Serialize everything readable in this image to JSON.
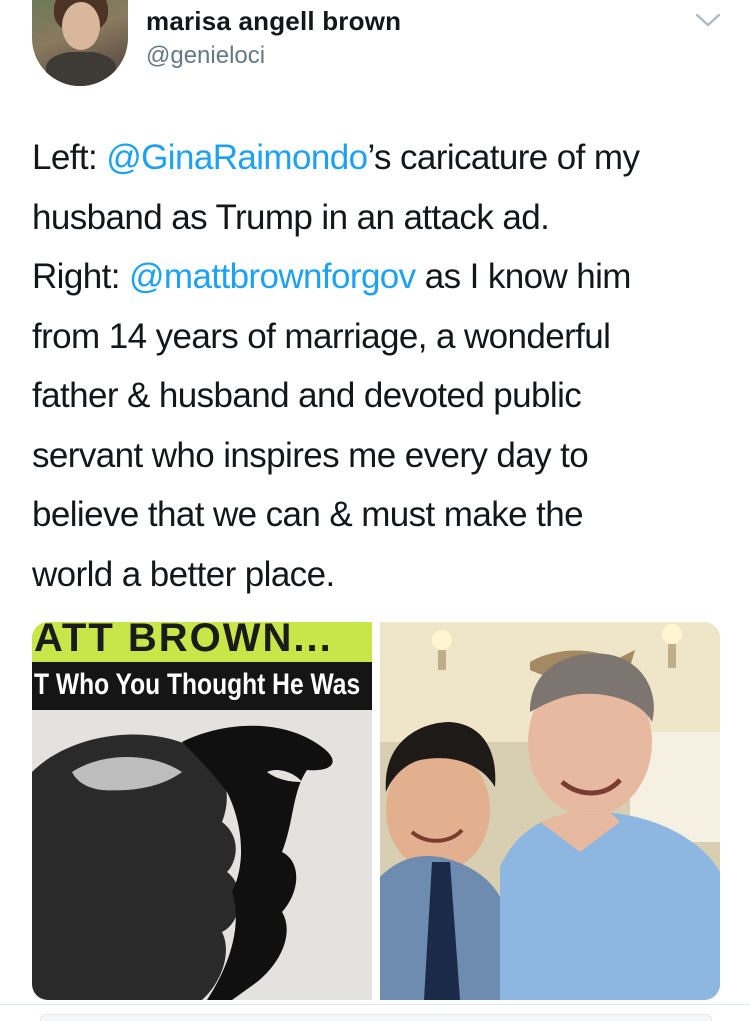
{
  "author": {
    "name": "marisa angell brown",
    "handle": "@genieloci"
  },
  "tweet": {
    "segments": [
      {
        "text": "Left: ",
        "mention": false
      },
      {
        "text": "@GinaRaimondo",
        "mention": true
      },
      {
        "text": "’s caricature of my\nhusband as Trump in an attack ad.\nRight: ",
        "mention": false
      },
      {
        "text": "@mattbrownforgov",
        "mention": true
      },
      {
        "text": " as I know him\nfrom 14 years of marriage, a wonderful\nfather & husband and devoted public\nservant who inspires me every day to\nbelieve that we can & must make the\nworld a better place.",
        "mention": false
      }
    ]
  },
  "media": {
    "left": {
      "banner_text": "ATT BROWN...",
      "subhead_text": "T Who You Thought He Was"
    }
  },
  "icons": {
    "menu": "chevron-down-icon"
  },
  "colors": {
    "mention": "#1da1f2",
    "text": "#14171a",
    "handle": "#657786",
    "banner": "#c8e64a"
  }
}
